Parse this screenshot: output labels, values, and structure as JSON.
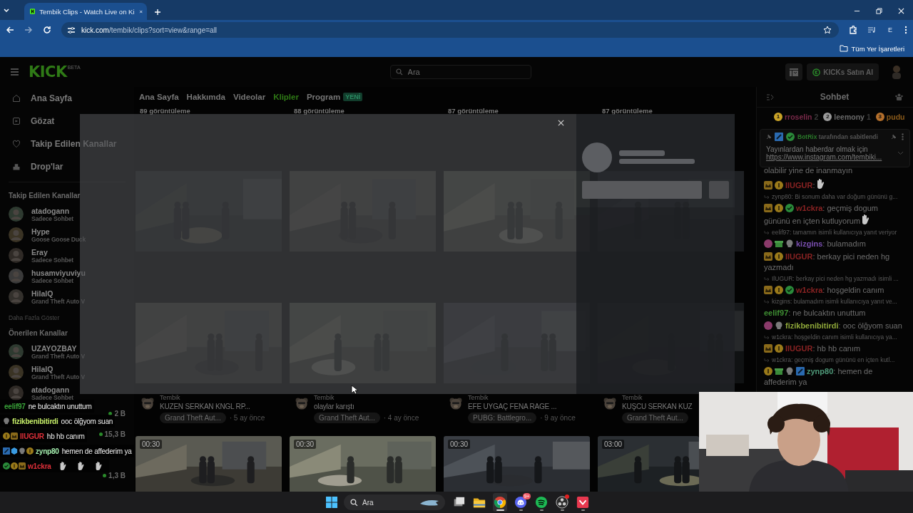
{
  "browser": {
    "tab": {
      "title": "Tembik Clips - Watch Live on Ki",
      "selected": true
    },
    "url_host": "kick.com",
    "url_path": "/tembik/clips?sort=view&range=all",
    "profile": "E",
    "bookmarks": "Tüm Yer İşaretleri"
  },
  "header": {
    "logo": "KICK",
    "logo_badge": "BETA",
    "search": {
      "placeholder": "Ara"
    },
    "buy_button": "KICKs Satın Al"
  },
  "sidebar": {
    "nav": [
      {
        "label": "Ana Sayfa",
        "kind": "home"
      },
      {
        "label": "Gözat",
        "kind": "browse"
      },
      {
        "label": "Takip Edilen Kanallar",
        "kind": "heart"
      },
      {
        "label": "Drop'lar",
        "kind": "gift"
      }
    ],
    "followed": {
      "title": "Takip Edilen Kanallar",
      "channels": [
        {
          "name": "atadogann",
          "subtitle": "Sadece Sohbet"
        },
        {
          "name": "Hype",
          "subtitle": "Goose Goose Duck"
        },
        {
          "name": "Eray",
          "subtitle": "Sadece Sohbet"
        },
        {
          "name": "husamviyuviyu",
          "subtitle": "Sadece Sohbet"
        },
        {
          "name": "HilalQ",
          "subtitle": "Grand Theft Auto V"
        }
      ]
    },
    "more": "Daha Fazla Göster",
    "recommended": {
      "title": "Önerilen Kanallar",
      "channels": [
        {
          "name": "UZAYOZBAY",
          "subtitle": "Grand Theft Auto V"
        },
        {
          "name": "HilalQ",
          "subtitle": "Grand Theft Auto V"
        },
        {
          "name": "atadogann",
          "subtitle": "Sadece Sohbet"
        },
        {
          "viewers": "2 B"
        },
        {
          "viewers": "15,3 B"
        },
        {
          "viewers": "1,3 B"
        }
      ]
    }
  },
  "channel_tabs": [
    {
      "label": "Ana Sayfa",
      "selected": false
    },
    {
      "label": "Hakkımda",
      "selected": false
    },
    {
      "label": "Videolar",
      "selected": false
    },
    {
      "label": "Klipler",
      "selected": true
    },
    {
      "label": "Program",
      "selected": false,
      "badge": "YENİ"
    }
  ],
  "clips_top": [
    {
      "views": "89 görüntüleme"
    },
    {
      "views": "88 görüntüleme"
    },
    {
      "views": "87 görüntüleme"
    },
    {
      "views": "87 görüntüleme"
    }
  ],
  "clips": [
    {
      "channel": "Tembik",
      "title": "KUZEN SERKAN KNGL RP...",
      "category": "Grand Theft Aut...",
      "age": "· 5 ay önce"
    },
    {
      "channel": "Tembik",
      "title": "olaylar karıştı",
      "category": "Grand Theft Aut...",
      "age": "· 4 ay önce"
    },
    {
      "channel": "Tembik",
      "title": "EFE UYGAÇ FENA RAGE ...",
      "category": "PUBG: Battlegro...",
      "age": "· 9 ay önce"
    },
    {
      "channel": "Tembik",
      "title": "KUŞCU SERKAN KUZ",
      "category": "Grand Theft Aut..."
    }
  ],
  "clips_next": [
    {
      "duration": "00:30"
    },
    {
      "duration": "00:30"
    },
    {
      "duration": "00:30"
    },
    {
      "duration": "03:00"
    }
  ],
  "chat": {
    "title": "Sohbet",
    "leaderboard": [
      {
        "rank": "1",
        "name": "rroselin",
        "count": "2",
        "color": "#c9a227"
      },
      {
        "rank": "2",
        "name": "leemony",
        "count": "1",
        "color": "#9a9a9a"
      },
      {
        "rank": "3",
        "name": "pudu",
        "color": "#b5702c"
      }
    ],
    "pinned": {
      "by": "BotRix",
      "by_suffix": "tarafından sabitlendi",
      "text": "Yayınlardan haberdar olmak için",
      "link": "https://www.instagram.com/tembiki..."
    },
    "messages": [
      {
        "kind": "text",
        "text": "olabilir yine de inanmayın"
      },
      {
        "kind": "message",
        "badges": [
          {
            "kind": "crown"
          },
          {
            "kind": "one"
          }
        ],
        "user": "IlUGUR",
        "color": "#8a2323",
        "text": ":",
        "emotes": true
      },
      {
        "kind": "reply",
        "text": "zynp80: Bi sonum daha var doğum gününü g..."
      },
      {
        "kind": "message",
        "badges": [
          {
            "kind": "crown"
          },
          {
            "kind": "one"
          },
          {
            "kind": "verified"
          }
        ],
        "user": "w1ckra",
        "color": "#8a2323",
        "text": ": geçmiş dogum gününü en içten kutluyorum",
        "emotes": true
      },
      {
        "kind": "reply",
        "text": "eelif97: tamamın isimli kullanıcıya yanıt veriyor"
      },
      {
        "kind": "message",
        "badges": [
          {
            "kind": "sub"
          },
          {
            "kind": "gift"
          },
          {
            "kind": "skull"
          }
        ],
        "user": "kizgins",
        "color": "#7a4fb0",
        "text": ": bulamadım",
        "emotes": false
      },
      {
        "kind": "message",
        "badges": [
          {
            "kind": "crown"
          },
          {
            "kind": "one"
          }
        ],
        "user": "IlUGUR",
        "color": "#8a2323",
        "text": ": berkay pici neden hg yazmadı",
        "emotes": false
      },
      {
        "kind": "reply",
        "text": "IlUGUR: berkay pici neden hg yazmadı isimli ..."
      },
      {
        "kind": "message",
        "badges": [
          {
            "kind": "crown"
          },
          {
            "kind": "one"
          },
          {
            "kind": "verified"
          }
        ],
        "user": "w1ckra",
        "color": "#8a2323",
        "text": ": hoşgeldin canım",
        "emotes": false
      },
      {
        "kind": "reply",
        "text": "kizgins: bulamadım isimli kullanıcıya yanıt ve..."
      },
      {
        "kind": "message",
        "user": "eelif97",
        "color": "#3f8f33",
        "text": ": ne bulcaktın unuttum",
        "emotes": false
      },
      {
        "kind": "message",
        "badges": [
          {
            "kind": "sub"
          },
          {
            "kind": "skull"
          }
        ],
        "user": "fizikbenibitirdi",
        "color": "#8fa83a",
        "text": ": ooc ölğyom suan",
        "emotes": false
      },
      {
        "kind": "reply",
        "text": "w1ckra: hoşgeldin canım isimli kullanıcıya ya..."
      },
      {
        "kind": "message",
        "badges": [
          {
            "kind": "crown"
          },
          {
            "kind": "one"
          }
        ],
        "user": "IlUGUR",
        "color": "#8a2323",
        "text": ": hb hb canım",
        "emotes": false
      },
      {
        "kind": "reply",
        "text": "w1ckra: geçmiş dogum gününü en içten kutl..."
      },
      {
        "kind": "message",
        "badges": [
          {
            "kind": "one"
          },
          {
            "kind": "gift"
          },
          {
            "kind": "skull"
          },
          {
            "kind": "bot"
          }
        ],
        "user": "zynp80",
        "color": "#4f9a7a",
        "text": ": hemen de affederim ya",
        "emotes": false
      }
    ]
  },
  "stream_chat": [
    {
      "user": "eelif97",
      "color": "#3aa53a",
      "text": "ne bulcaktın unuttum",
      "emotes": false
    },
    {
      "user": "fizikbenibitirdi",
      "color": "#c8f06a",
      "text": "ooc ölğyom suan",
      "badges": [
        {
          "kind": "skull"
        }
      ],
      "emotes": false
    },
    {
      "user": "IlUGUR",
      "color": "#e0303a",
      "text": "hb hb canım",
      "badges": [
        {
          "kind": "one"
        },
        {
          "kind": "crown"
        }
      ],
      "emotes": false
    },
    {
      "user": "zynp80",
      "color": "#a6f0b0",
      "text": "hemen de affederim ya",
      "badges": [
        {
          "kind": "bot"
        },
        {
          "kind": "cube"
        },
        {
          "kind": "skull"
        },
        {
          "kind": "one"
        }
      ],
      "emotes": false
    },
    {
      "user": "w1ckra",
      "color": "#e0303a",
      "badges": [
        {
          "kind": "verified"
        },
        {
          "kind": "one"
        },
        {
          "kind": "crown"
        }
      ],
      "emotes": true
    }
  ],
  "taskbar": {
    "search": {
      "placeholder": "Ara"
    },
    "apps": [
      {
        "kind": "taskview",
        "running": false,
        "active": false
      },
      {
        "kind": "folder",
        "running": false,
        "active": false
      },
      {
        "kind": "chrome",
        "running": true,
        "active": true
      },
      {
        "kind": "discord",
        "running": true,
        "active": false,
        "badge": "9+"
      },
      {
        "kind": "spotify",
        "running": true,
        "active": false
      },
      {
        "kind": "obs",
        "running": true,
        "active": false,
        "alert": true
      },
      {
        "kind": "valorant",
        "running": true,
        "active": false
      }
    ]
  }
}
